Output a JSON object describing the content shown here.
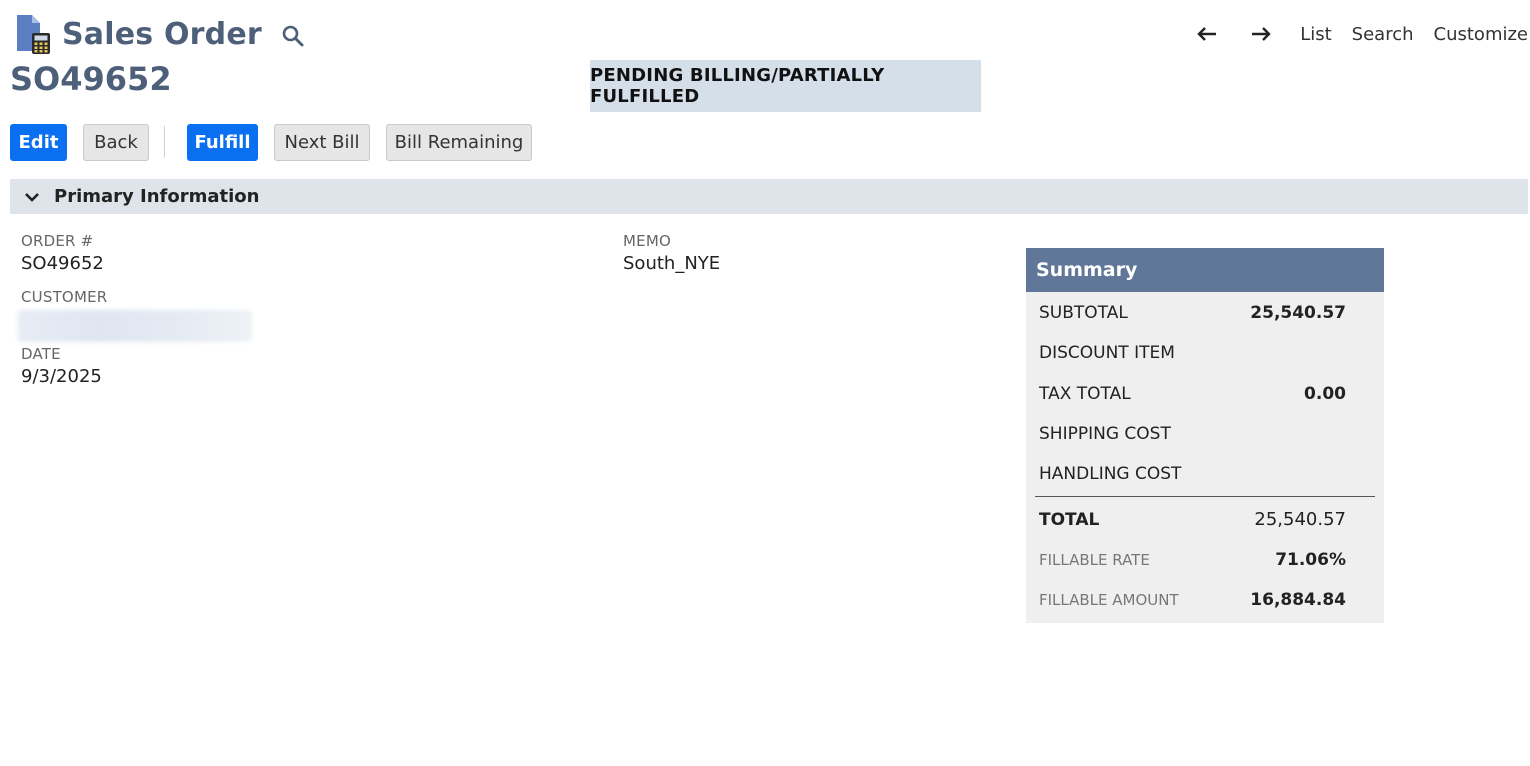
{
  "header": {
    "page_type": "Sales Order",
    "record_number": "SO49652",
    "status": "PENDING BILLING/PARTIALLY FULFILLED",
    "nav": {
      "list": "List",
      "search": "Search",
      "customize": "Customize"
    }
  },
  "buttons": {
    "edit": "Edit",
    "back": "Back",
    "fulfill": "Fulfill",
    "next_bill": "Next Bill",
    "bill_remaining": "Bill Remaining"
  },
  "section": {
    "title": "Primary Information"
  },
  "fields": {
    "order_label": "ORDER #",
    "order_value": "SO49652",
    "customer_label": "CUSTOMER",
    "date_label": "DATE",
    "date_value": "9/3/2025",
    "memo_label": "MEMO",
    "memo_value": "South_NYE"
  },
  "summary": {
    "title": "Summary",
    "subtotal_label": "SUBTOTAL",
    "subtotal_value": "25,540.57",
    "discount_label": "DISCOUNT ITEM",
    "discount_value": "",
    "tax_label": "TAX TOTAL",
    "tax_value": "0.00",
    "shipping_label": "SHIPPING COST",
    "shipping_value": "",
    "handling_label": "HANDLING COST",
    "handling_value": "",
    "total_label": "TOTAL",
    "total_value": "25,540.57",
    "fillable_rate_label": "FILLABLE RATE",
    "fillable_rate_value": "71.06%",
    "fillable_amount_label": "FILLABLE AMOUNT",
    "fillable_amount_value": "16,884.84"
  },
  "colors": {
    "title": "#4d5f79",
    "primary_button": "#0a6ff0",
    "status_badge": "#d5dfea",
    "section_header": "#dfe4eb",
    "summary_header": "#607799"
  },
  "icons": {
    "record": "sales-order-document-icon",
    "search": "search-icon",
    "prev": "arrow-left-icon",
    "next": "arrow-right-icon",
    "collapse": "chevron-down-icon"
  }
}
